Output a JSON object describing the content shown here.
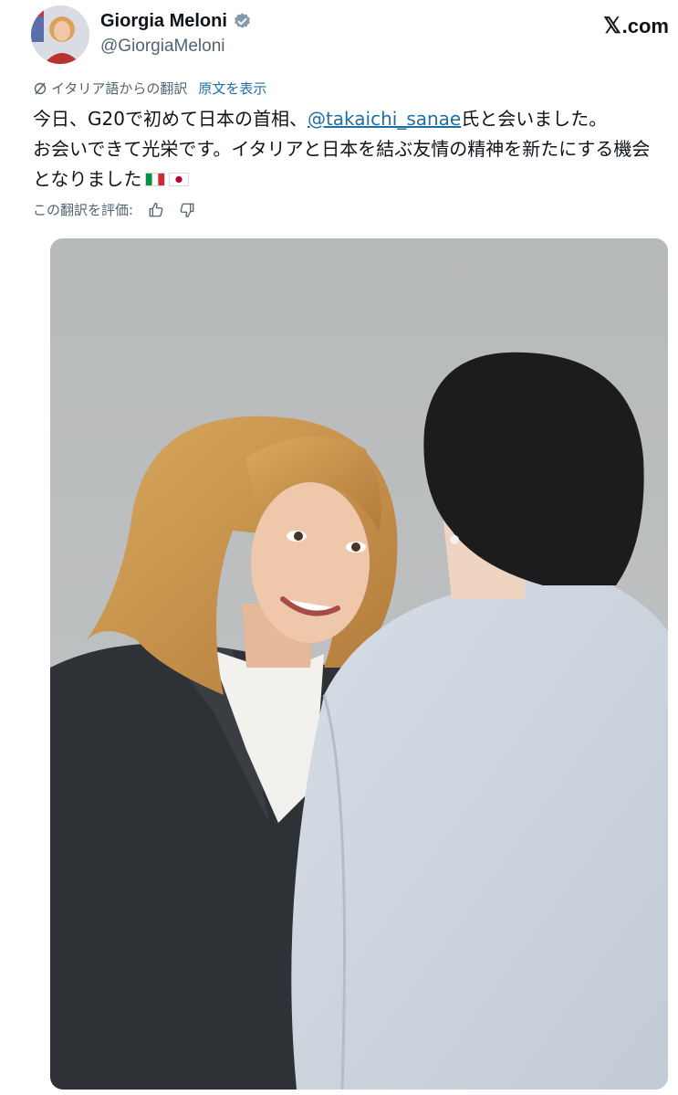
{
  "author": {
    "display_name": "Giorgia Meloni",
    "handle": "@GiorgiaMeloni",
    "verified_icon": "verified-badge-icon",
    "avatar_icon": "profile-avatar"
  },
  "brand": {
    "label": ".com",
    "logo": "𝕏"
  },
  "translation": {
    "label": "イタリア語からの翻訳",
    "show_original": "原文を表示"
  },
  "tweet": {
    "line1_pre": "今日、G20で初めて日本の首相、",
    "mention": "@takaichi_sanae",
    "line1_post": "氏と会いました。",
    "line2": "お会いできて光栄です。イタリアと日本を結ぶ友情の精神を新たにする機会",
    "line3": "となりました"
  },
  "rating": {
    "label": "この翻訳を評価:"
  },
  "colors": {
    "link": "#1d6fa5",
    "secondary_text": "#536471",
    "verified": "#829aab"
  }
}
